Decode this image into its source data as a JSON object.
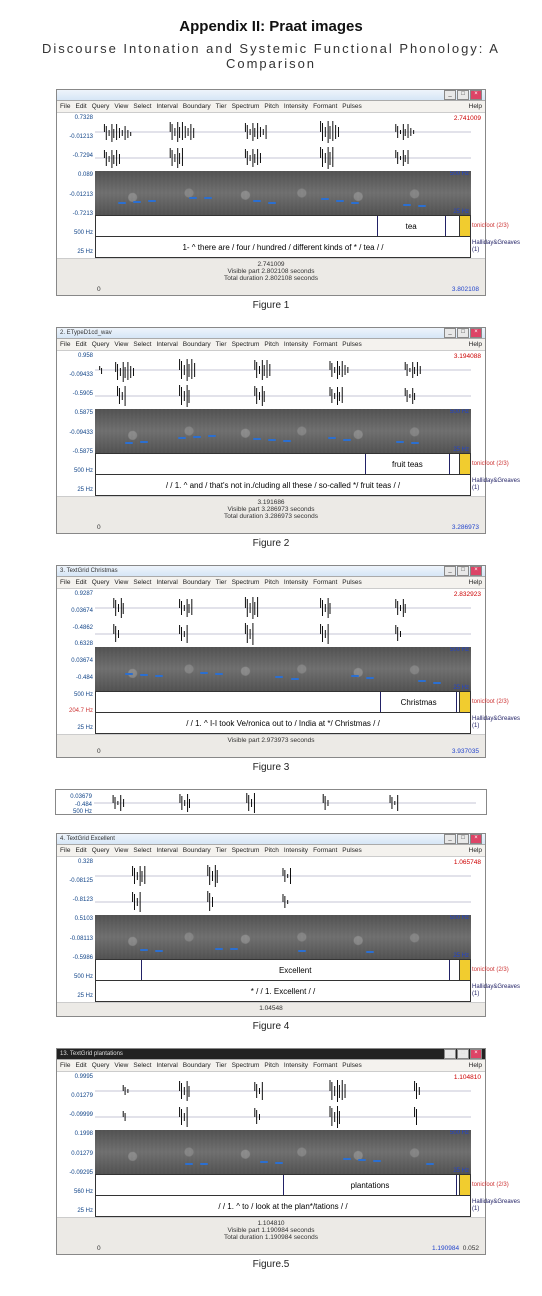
{
  "page": {
    "title": "Appendix II: Praat images",
    "subtitle": "Discourse Intonation and Systemic Functional Phonology: A Comparison"
  },
  "menus": {
    "items": [
      "File",
      "Edit",
      "Query",
      "View",
      "Select",
      "Interval",
      "Boundary",
      "Tier",
      "Spectrum",
      "Pitch",
      "Intensity",
      "Formant",
      "Pulses"
    ],
    "help": "Help"
  },
  "tier_side": {
    "top": "tonicfoot (2/3)",
    "bottom": "Halliday&Greaves (1)"
  },
  "figures": [
    {
      "caption": "Figure 1",
      "window_title": "",
      "duration_top_right": "2.741009",
      "left_axis": [
        "0.7328",
        "-0.01213",
        "-0.7294",
        "0.089",
        "-0.01213",
        "-0.7213",
        "500 Hz",
        "25 Hz"
      ],
      "hz_right_top": "500 Hz",
      "hz_right_bot": "25 Hz",
      "tonic_word": "tea",
      "transcript": "1- ^ there are / four / hundred / different kinds of * / tea / /",
      "footer_center_top": "2.741009",
      "footer_line1": "Visible part 2.802108 seconds",
      "footer_line2": "Total duration 2.802108 seconds",
      "footer_left": "0",
      "footer_right": "3.802108"
    },
    {
      "caption": "Figure 2",
      "window_title": "2. ETypeD1cd_wav",
      "duration_top_right": "3.194088",
      "left_axis": [
        "0.958",
        "-0.09433",
        "-0.5905",
        "0.5875",
        "-0.09433",
        "-0.5875",
        "500 Hz",
        "25 Hz"
      ],
      "hz_right_top": "500 Hz",
      "hz_right_bot": "25 Hz",
      "tonic_word": "fruit teas",
      "transcript": "/ / 1. ^ and / that's not in./cluding all these / so-called */ fruit teas / /",
      "footer_center_top": "3.191686",
      "footer_line1": "Visible part 3.286973 seconds",
      "footer_line2": "Total duration 3.286973 seconds",
      "footer_left": "0",
      "footer_right": "3.286973"
    },
    {
      "caption": "Figure 3",
      "window_title": "3. TextGrid Christmas",
      "duration_top_right": "2.832923",
      "left_axis": [
        "0.9287",
        "0.03674",
        "-0.4862",
        "0.6328",
        "0.03674",
        "-0.484",
        "500 Hz",
        "204.7 Hz",
        "25 Hz"
      ],
      "hz_right_top": "500 Hz",
      "hz_right_bot": "25 Hz",
      "tonic_word": "Christmas",
      "transcript": "/ / 1. ^ I-I took Ve/ronica out to / India at */ Christmas / /",
      "footer_center_top": "Visible part 2.973973 seconds",
      "footer_line1": "",
      "footer_line2": "",
      "footer_left": "0",
      "footer_right": "3.937035"
    },
    {
      "caption": "Figure 4",
      "window_title": "4. TextGrid Excellent",
      "duration_top_right": "1.065748",
      "left_axis": [
        "0.328",
        "-0.08125",
        "-0.8123",
        "0.5103",
        "-0.08113",
        "-0.5986",
        "500 Hz",
        "25 Hz"
      ],
      "hz_right_top": "500 Hz",
      "hz_right_bot": "25 Hz",
      "tonic_word": "Excellent",
      "transcript": "* / / 1. Excellent / /",
      "footer_center_top": "1.04548",
      "footer_line1": "",
      "footer_line2": "",
      "footer_left": "",
      "footer_right": ""
    },
    {
      "caption": "Figure.5",
      "window_title": "13. TextGrid plantations",
      "duration_top_right": "1.104810",
      "left_axis": [
        "0.9995",
        "0.01279",
        "-0.09999",
        "0.1998",
        "0.01279",
        "-0.09295",
        "560 Hz",
        "25 Hz"
      ],
      "hz_right_top": "500 Hz",
      "hz_right_bot": "25 Hz",
      "tonic_word": "plantations",
      "transcript": "/ / 1. ^ to / look at the plan*/tations / /",
      "footer_center_top": "1.104810",
      "footer_line1": "Visible part 1.190984 seconds",
      "footer_line2": "Total duration 1.190984 seconds",
      "footer_left": "0",
      "footer_right": "1.190984",
      "footer_right2": "0.052"
    }
  ],
  "partial": {
    "left_axis": [
      "0.03679",
      "-0.484",
      "500 Hz"
    ]
  }
}
